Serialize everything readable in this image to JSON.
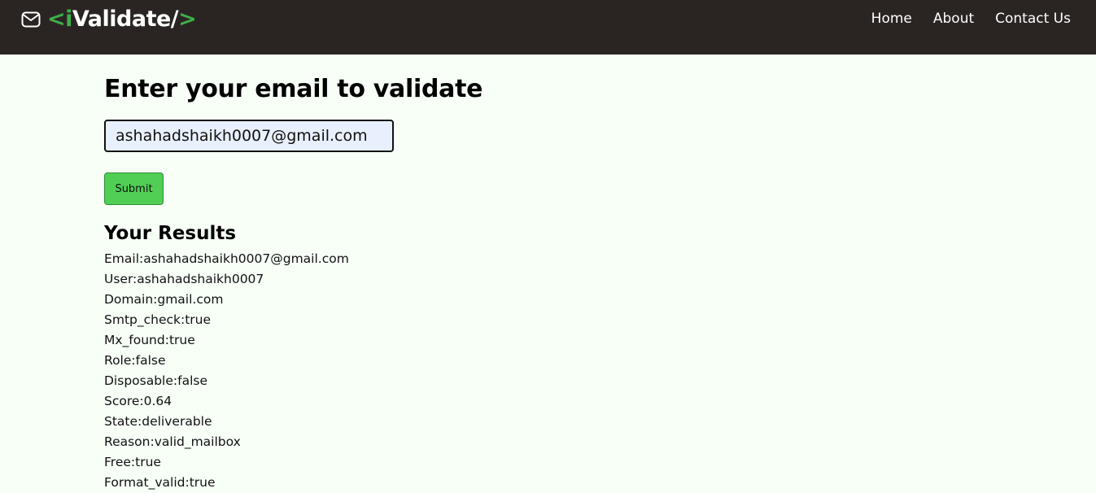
{
  "nav": {
    "logo_open": "<",
    "logo_i": "i",
    "logo_name": "Validate/",
    "logo_close": ">",
    "links": [
      "Home",
      "About",
      "Contact Us"
    ]
  },
  "form": {
    "heading": "Enter your email to validate",
    "email_value": "ashahadshaikh0007@gmail.com",
    "submit_label": "Submit"
  },
  "results": {
    "title": "Your Results",
    "lines": [
      "Email:ashahadshaikh0007@gmail.com",
      "User:ashahadshaikh0007",
      "Domain:gmail.com",
      "Smtp_check:true",
      "Mx_found:true",
      "Role:false",
      "Disposable:false",
      "Score:0.64",
      "State:deliverable",
      "Reason:valid_mailbox",
      "Free:true",
      "Format_valid:true"
    ]
  },
  "colors": {
    "navbar_bg": "#2a2523",
    "accent_green": "#3fae49",
    "button_green": "#51cf55",
    "page_bg": "#f7fff7"
  },
  "icons": [
    "mail-icon"
  ]
}
